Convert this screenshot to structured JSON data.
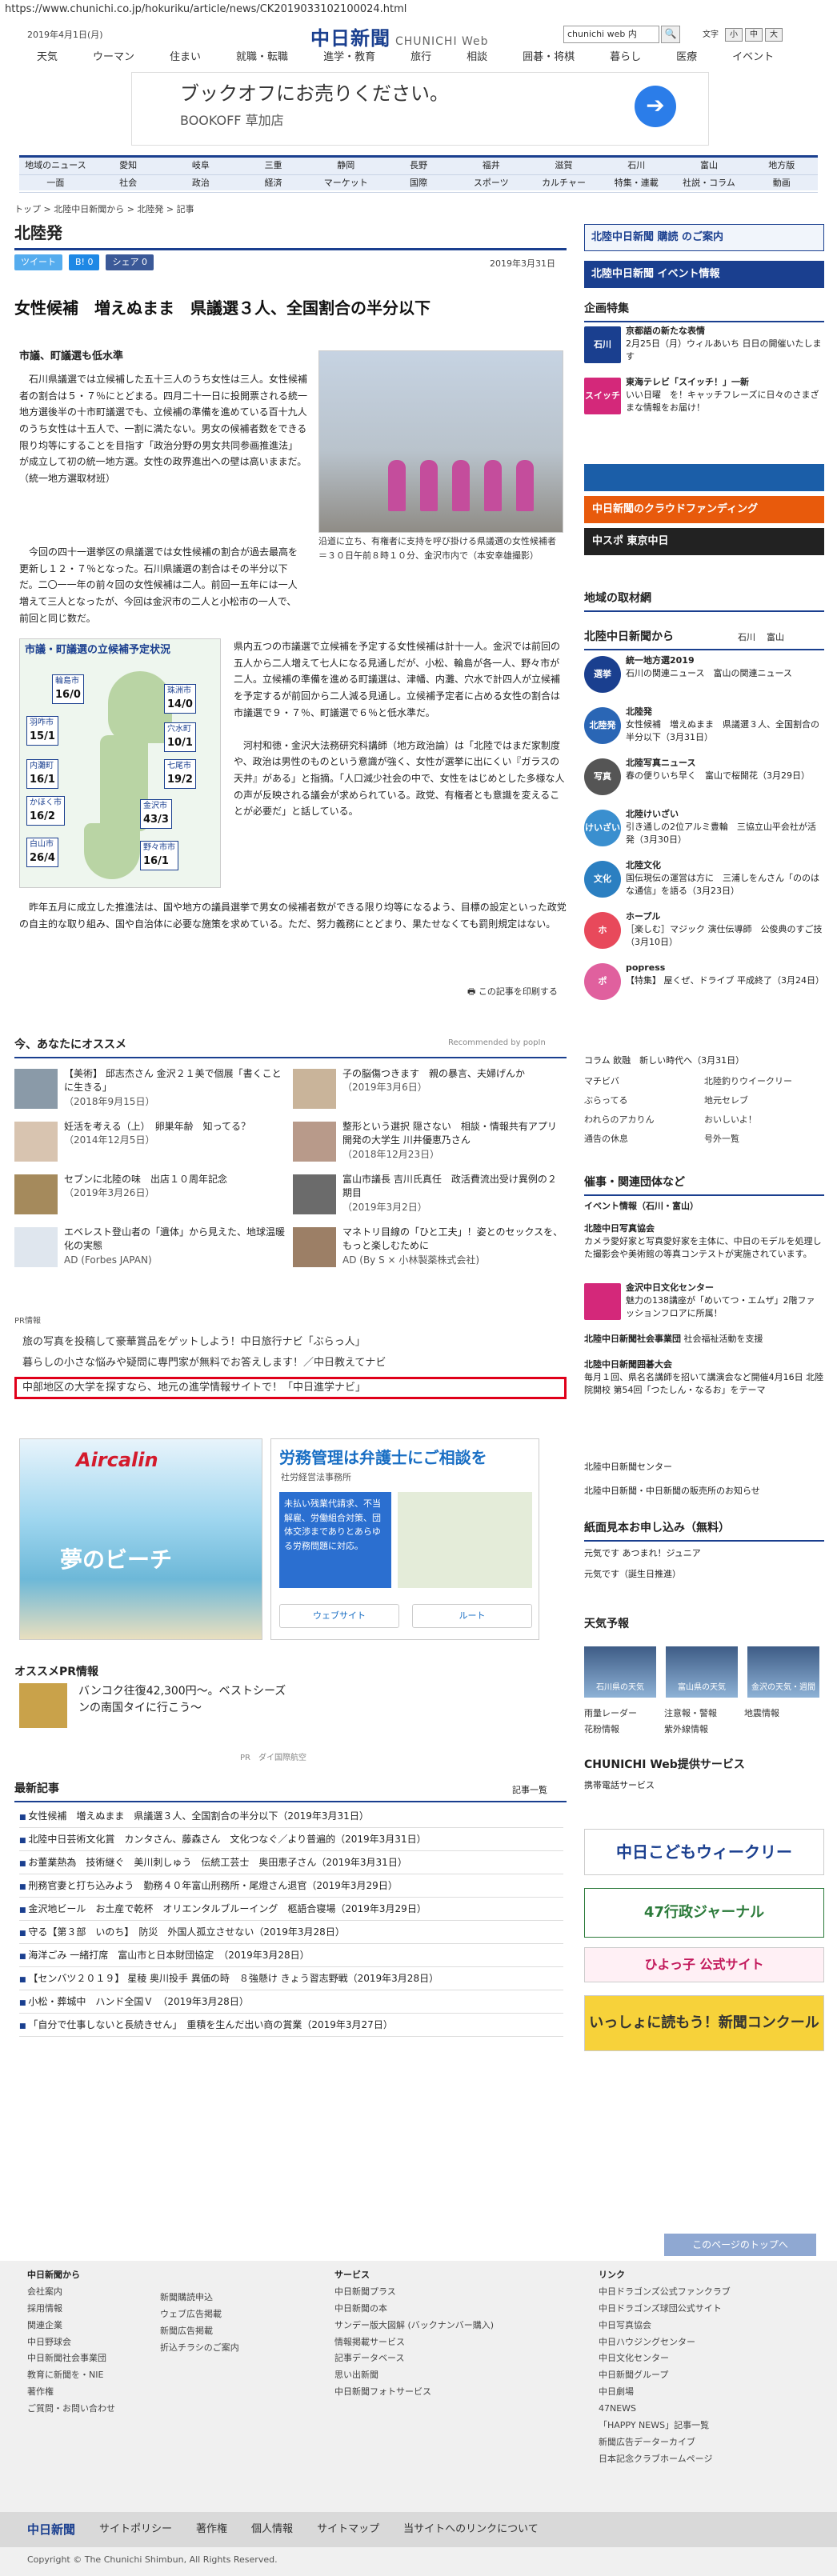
{
  "url": "https://www.chunichi.co.jp/hokuriku/article/news/CK2019033102100024.html",
  "header": {
    "date": "2019年4月1日(月)",
    "logo": "中日新聞",
    "logo_sub": "CHUNICHI Web",
    "search_value": "chunichi web 内",
    "search_btn": "🔍",
    "font_label": "文字",
    "font_small": "小",
    "font_mid": "中",
    "font_large": "大"
  },
  "topnav": [
    "天気",
    "ウーマン",
    "住まい",
    "就職・転職",
    "進学・教育",
    "旅行",
    "相談",
    "囲碁・将棋",
    "暮らし",
    "医療",
    "イベント"
  ],
  "ad1": {
    "title": "ブックオフにお売りください。",
    "sub": "BOOKOFF 草加店",
    "go": "➔"
  },
  "nav2": {
    "row1": [
      "地域のニュース",
      "愛知",
      "岐阜",
      "三重",
      "静岡",
      "長野",
      "福井",
      "滋賀",
      "石川",
      "富山",
      "地方版"
    ],
    "row2": [
      "一面",
      "社会",
      "政治",
      "経済",
      "マーケット",
      "国際",
      "スポーツ",
      "カルチャー",
      "特集・連載",
      "社説・コラム",
      "動画"
    ]
  },
  "breadcrumb": "トップ > 北陸中日新聞から > 北陸発 > 記事",
  "section": "北陸発",
  "share": {
    "tweet": "ツイート",
    "b": "B! 0",
    "fb": "シェア 0"
  },
  "pubdate": "2019年3月31日",
  "headline": "女性候補　増えぬまま　県議選３人、全国割合の半分以下",
  "subhead": "市議、町議選も低水準",
  "para1": "　石川県議選では立候補した五十三人のうち女性は三人。女性候補者の割合は５・７％にとどまる。四月二十一日に投開票される統一地方選後半の十市町議選でも、立候補の準備を進めている百十九人のうち女性は十五人で、一割に満たない。男女の候補者数をできる限り均等にすることを目指す「政治分野の男女共同参画推進法」が成立して初の統一地方選。女性の政界進出への壁は高いままだ。（統一地方選取材班）",
  "photo_caption": "沿道に立ち、有権者に支持を呼び掛ける県議選の女性候補者＝３０日午前８時１０分、金沢市内で（本安幸雄撮影）",
  "para2": "　今回の四十一選挙区の県議選では女性候補の割合が過去最高を更新し１２・７％となった。石川県議選の割合はその半分以下だ。二〇一一年の前々回の女性候補は二人。前回一五年には一人増えて三人となったが、今回は金沢市の二人と小松市の一人で、前回と同じ数だ。",
  "map": {
    "title": "市議・町議選の立候補予定状況",
    "areas": [
      {
        "n": "輪島市",
        "v": "16/0"
      },
      {
        "n": "珠洲市",
        "v": "14/0"
      },
      {
        "n": "羽咋市",
        "v": "15/1"
      },
      {
        "n": "穴水町",
        "v": "10/1"
      },
      {
        "n": "七尾市",
        "v": "19/2"
      },
      {
        "n": "内灘町",
        "v": "16/1"
      },
      {
        "n": "かほく市",
        "v": "16/2"
      },
      {
        "n": "金沢市",
        "v": "43/3"
      },
      {
        "n": "白山市",
        "v": "26/4"
      },
      {
        "n": "野々市市",
        "v": "16/1"
      }
    ]
  },
  "para3": "県内五つの市議選で立候補を予定する女性候補は計十一人。金沢では前回の五人から二人増えて七人になる見通しだが、小松、輪島が各一人、野々市が二人。立候補の準備を進める町議選は、津幡、内灘、穴水で計四人が立候補を予定するが前回から二人減る見通し。立候補予定者に占める女性の割合は市議選で９・７％、町議選で６％と低水準だ。\n\n　河村和徳・金沢大法務研究科講師（地方政治論）は「北陸ではまだ家制度や、政治は男性のものという意識が強く、女性が選挙に出にくい『ガラスの天井』がある」と指摘。「人口減少社会の中で、女性をはじめとした多様な人の声が反映される議会が求められている。政党、有権者とも意識を変えることが必要だ」と話している。",
  "para4": "　昨年五月に成立した推進法は、国や地方の議員選挙で男女の候補者数ができる限り均等になるよう、目標の設定といった政党の自主的な取り組み、国や自治体に必要な施策を求めている。ただ、努力義務にとどまり、果たせなくても罰則規定はない。",
  "print": "この記事を印刷する",
  "recommend": {
    "title": "今、あなたにオススメ",
    "powered": "Recommended by popIn",
    "items": [
      {
        "t": "【美術】 邱志杰さん 金沢２１美で個展「書くことに生きる」",
        "d": "（2018年9月15日）"
      },
      {
        "t": "子の脳傷つきます　親の暴言、夫婦げんか",
        "d": "（2019年3月6日）"
      },
      {
        "t": "妊活を考える（上）　卵巣年齢　知ってる？",
        "d": "（2014年12月5日）"
      },
      {
        "t": "整形という選択 隠さない　相談・情報共有アプリ開発の大学生 川井優恵乃さん",
        "d": "（2018年12月23日）"
      },
      {
        "t": "セブンに北陸の味　出店１０周年記念",
        "d": "（2019年3月26日）"
      },
      {
        "t": "富山市議長 吉川氏真任　政活費流出受け異例の２期目",
        "d": "（2019年3月2日）"
      },
      {
        "t": "エベレスト登山者の「遺体」から見えた、地球温暖化の実態",
        "d": "AD (Forbes JAPAN)"
      },
      {
        "t": "マネトリ目線の「ひと工夫」！姿とのセックスを、もっと楽しむために",
        "d": "AD (By S × 小林製薬株式会社)"
      }
    ]
  },
  "pr": {
    "label": "PR情報",
    "items": [
      "旅の写真を投稿して豪華賞品をゲットしよう！中日旅行ナビ「ぶらっ人」",
      "暮らしの小さな悩みや疑問に専門家が無料でお答えします！／中日教えてナビ",
      "中部地区の大学を探すなら、地元の進学情報サイトで！「中日進学ナビ」"
    ]
  },
  "ad2": {
    "brand": "Aircalin",
    "caption": "夢のビーチ"
  },
  "ad3": {
    "title": "労務管理は弁護士にご相談を",
    "sub": "社労経営法事務所",
    "blue": "未払い残業代請求、不当解雇、労働組合対策、団体交渉までありとあらゆる労務問題に対応。",
    "site": "ウェブサイト",
    "route": "ルート"
  },
  "osusume": {
    "title": "オススメPR情報",
    "item": "バンコク往復42,300円～。ベストシーズンの南国タイに行こう～",
    "ad": "PR　ダイ国際航空"
  },
  "latest": {
    "title": "最新記事",
    "more": "記事一覧",
    "items": [
      "女性候補　増えぬまま　県議選３人、全国割合の半分以下（2019年3月31日）",
      "北陸中日芸術文化賞　カンタさん、藤森さん　文化つなぐ／より普遍的（2019年3月31日）",
      "お董業熱為　技術継ぐ　美川刺しゅう　伝統工芸士　奥田恵子さん（2019年3月31日）",
      "刑務官妻と打ち込みよう　勤務４０年富山刑務所・尾燈さん退官（2019年3月29日）",
      "金沢地ビール　お土産で乾杯　オリエンタルブルーイング　柩語合寝場（2019年3月29日）",
      "守る【第３部　いのち】　防災　外国人孤立させない（2019年3月28日）",
      "海洋ごみ 一緒打席　富山市と日本財団協定　（2019年3月28日）",
      "【センバツ２０１９】 星稜 奥川投手 異価の時　８強懸け きょう習志野戦（2019年3月28日）",
      "小松・葬城中　ハンド全国Ｖ　（2019年3月28日）",
      "「自分で仕事しないと長続きせん」　重積を生んだ出い商の賞業（2019年3月27日）"
    ]
  },
  "sidebar": {
    "sub": "北陸中日新聞 購読 のご案内",
    "event": "北陸中日新聞 イベント情報",
    "kikaku": "企画特集",
    "kikaku_items": [
      {
        "ic": "石川",
        "t": "京都語の新たな表情",
        "d": "2月25日（月）ウィルあいち 日日の開催いたします"
      },
      {
        "ic": "スイッチ",
        "t": "東海テレビ「スイッチ！」一新",
        "d": "いい日曜　を！キャッチフレーズに日々のさまざまな情報をお届け！"
      }
    ],
    "cloud": "中日新聞のクラウドファンディング",
    "chuspo": "中スポ 東京中日",
    "chiiki": "地域の取材網",
    "from": "北陸中日新聞から",
    "from_tabs": [
      "石川",
      "富山"
    ],
    "from_items": [
      {
        "ic": "選挙",
        "t": "統一地方選2019",
        "d": "石川の関連ニュース　富山の関連ニュース"
      },
      {
        "ic": "北陸発",
        "t": "北陸発",
        "d": "女性候補　増えぬまま　県議選３人、全国割合の半分以下（3月31日）"
      },
      {
        "ic": "写真",
        "t": "北陸写真ニュース",
        "d": "春の便りいち早く　富山で桜開花（3月29日）"
      },
      {
        "ic": "けいざい",
        "t": "北陸けいざい",
        "d": "引き通しの2位アルミ豊輪　三協立山平会社が活発（3月30日）"
      },
      {
        "ic": "文化",
        "t": "北陸文化",
        "d": "国伝現伝の運営は方に　三浦しをんさん「ののはな通信」を語る（3月23日）"
      },
      {
        "ic": "ホ",
        "t": "ホープル",
        "d": "［楽しむ］マジック 演仕伝導師　公俊典のすご技（3月10日）"
      },
      {
        "ic": "ポ",
        "t": "popress",
        "d": "【特集】 屋くぜ、ドライブ  平成終了（3月24日）"
      }
    ],
    "column": "コラム 飲融　新しい時代へ（3月31日）",
    "links": [
      "マチビバ",
      "北陸釣りウイークリー",
      "ぶらってる",
      "地元セレブ",
      "われらのアカりん",
      "おいしいよ！",
      "通告の休息",
      "号外一覧"
    ],
    "kan": "催事・関連団体など",
    "event_area": "イベント情報（石川・富山）",
    "ev_items": [
      {
        "t": "北陸中日写真協会",
        "d": "カメラ愛好家と写真愛好家を主体に、中日のモデルを処理した撮影会や美術館の等真コンテストが実施されています。"
      },
      {
        "t": "金沢中日文化センター",
        "d": "魅力の138講座が「めいてつ・エムザ」2階ファッションフロアに所属！"
      },
      {
        "t": "北陸中日新聞社会事業団",
        "d": "社会福祉活動を支援"
      },
      {
        "t": "北陸中日新聞囲碁大会",
        "d": "毎月１回、県名名講師を招いて講演会など開催4月16日 北陸院開校 第54回「つたしん・なるお」をテーマ"
      }
    ],
    "misc": [
      "北陸中日新聞センター",
      "北陸中日新聞・中日新聞の販売所のお知らせ"
    ],
    "shimen": "紙面見本お申し込み（無料）",
    "shimen_items": [
      "元気です あつまれ！ジュニア",
      "元気です（誕生日推進）"
    ],
    "tenki": "天気予報",
    "weather": [
      "石川県の天気",
      "富山県の天気",
      "金沢の天気・週間"
    ],
    "wx_links": [
      "雨量レーダー",
      "注意報・警報",
      "地震情報",
      "花粉情報",
      "紫外線情報"
    ],
    "svc": "CHUNICHI Web提供サービス",
    "svc_item": "携帯電話サービス",
    "kodomo": "中日こどもウィークリー",
    "gyosei": "47行政ジャーナル",
    "hiyoko": "ひよっ子 公式サイト",
    "nie": "いっしょに読もう！新聞コンクール"
  },
  "pagetop": "このページのトップへ",
  "footer": {
    "c1": {
      "h": "中日新聞から",
      "items": [
        "会社案内",
        "採用情報",
        "関連企業",
        "中日野球会",
        "中日新聞社会事業団",
        "教育に新聞を・NIE",
        "著作権",
        "ご質問・お問い合わせ"
      ]
    },
    "c2": {
      "items": [
        "新聞購読申込",
        "ウェブ広告掲載",
        "新聞広告掲載",
        "折込チラシのご案内"
      ]
    },
    "c3": {
      "h": "サービス",
      "items": [
        "中日新聞プラス",
        "中日新聞の本",
        "サンデー版大図解 (バックナンバー購入)",
        "情報掲載サービス",
        "記事データベース",
        "思い出新聞",
        "中日新聞フォトサービス"
      ]
    },
    "c4": {
      "h": "リンク",
      "items": [
        "中日ドラゴンズ公式ファンクラブ",
        "中日ドラゴンズ球団公式サイト",
        "中日写真協会",
        "中日ハウジングセンター",
        "中日文化センター",
        "中日新聞グループ",
        "中日劇場",
        "47NEWS",
        "「HAPPY NEWS」記事一覧",
        "新聞広告データーカイブ",
        "日本記念クラブホームページ"
      ]
    }
  },
  "fbar": [
    "中日新聞",
    "サイトポリシー",
    "著作権",
    "個人情報",
    "サイトマップ",
    "当サイトへのリンクについて"
  ],
  "copyright": "Copyright © The Chunichi Shimbun, All Rights Reserved."
}
